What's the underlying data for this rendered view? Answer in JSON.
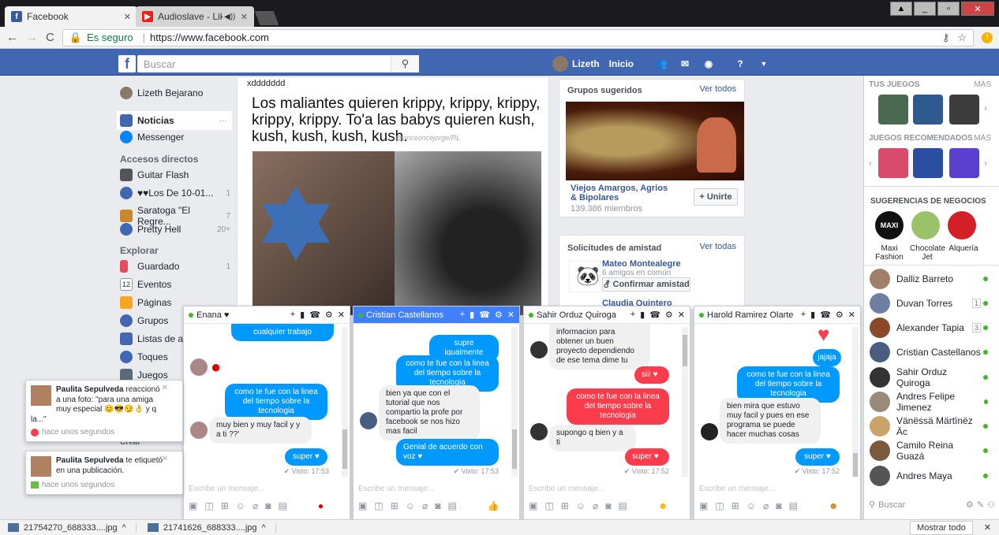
{
  "browser": {
    "tabs": [
      {
        "title": "Facebook",
        "active": true
      },
      {
        "title": "Audioslave - Like a St",
        "active": false
      }
    ],
    "secure_label": "Es seguro",
    "url": "https://www.facebook.com",
    "downloads": [
      "21754270_688333....jpg",
      "21741626_688333....jpg"
    ],
    "show_all": "Mostrar todo"
  },
  "fb_header": {
    "search_placeholder": "Buscar",
    "user_name": "Lizeth",
    "home_label": "Inicio",
    "brand_color": "#4267b2"
  },
  "left_nav": {
    "profile": "Lizeth Bejarano",
    "items": [
      {
        "label": "Noticias",
        "extra": "···"
      },
      {
        "label": "Messenger",
        "extra": ""
      }
    ],
    "shortcuts_title": "Accesos directos",
    "shortcuts": [
      {
        "label": "Guitar Flash",
        "count": ""
      },
      {
        "label": "♥♥Los De 10-01...",
        "count": "1"
      },
      {
        "label": "Saratoga \"El Regre...",
        "count": "7"
      },
      {
        "label": "Pretty Hell",
        "count": "20+"
      }
    ],
    "explore_title": "Explorar",
    "explore": [
      {
        "label": "Guardado",
        "count": "1"
      },
      {
        "label": "Eventos",
        "count": ""
      },
      {
        "label": "Páginas",
        "count": ""
      },
      {
        "label": "Grupos",
        "count": ""
      },
      {
        "label": "Listas de am",
        "count": ""
      },
      {
        "label": "Toques",
        "count": ""
      },
      {
        "label": "Juegos",
        "count": ""
      }
    ],
    "create": "Crear"
  },
  "post": {
    "author_line": "xddddddd",
    "text": "Los maliantes quieren krippy, krippy, krippy, krippy, krippy. To'a las babys quieren kush, kush, kush, kush, kush.",
    "watermark": "@onceoncejorge/RL"
  },
  "suggested_groups": {
    "title": "Grupos sugeridos",
    "see_all": "Ver todos",
    "group_name": "Viejos Amargos, Agrios & Bipolares",
    "members": "139.386 miembros",
    "join": "+ Unirte"
  },
  "friend_requests": {
    "title": "Solicitudes de amistad",
    "see_all": "Ver todas",
    "requests": [
      {
        "name": "Mateo Montealegre",
        "mutual": "6 amigos en común",
        "confirm": "Confirmar amistad"
      },
      {
        "name": "Claudia Quintero",
        "mutual": "",
        "confirm": ""
      }
    ]
  },
  "sidebar": {
    "games_title": "TUS JUEGOS",
    "more": "MÁS",
    "recommended_title": "JUEGOS RECOMENDADOS",
    "business_title": "SUGERENCIAS DE NEGOCIOS",
    "businesses": [
      "Maxi Fashion",
      "Chocolate Jet",
      "Alquería"
    ],
    "contacts": [
      {
        "name": "Dalliz Barreto",
        "badge": ""
      },
      {
        "name": "Duvan Torres",
        "badge": "1"
      },
      {
        "name": "Alexander Tapia",
        "badge": "3"
      },
      {
        "name": "Cristian Castellanos",
        "badge": ""
      },
      {
        "name": "Sahir Orduz Quiroga",
        "badge": ""
      },
      {
        "name": "Andres Felipe Jimenez",
        "badge": ""
      },
      {
        "name": "Vänëssä Märtïnëz Äc",
        "badge": ""
      },
      {
        "name": "Camilo Reina Guazá",
        "badge": ""
      },
      {
        "name": "Andres Maya",
        "badge": ""
      }
    ],
    "search_placeholder": "Buscar"
  },
  "chats": [
    {
      "name": "Enana ♥",
      "messages": [
        {
          "side": "me",
          "text": "cualquier trabajo"
        },
        {
          "side": "me",
          "text": "como te fue con la linea del tiempo sobre la tecnologia"
        },
        {
          "side": "they",
          "text": "muy bien y muy facil y y a ti ??'"
        },
        {
          "side": "me",
          "text": "super ♥"
        }
      ],
      "seen": "✔ Visto: 17:53",
      "placeholder": "Escribe un mensaje..."
    },
    {
      "name": "Cristian Castellanos",
      "messages": [
        {
          "side": "me",
          "text": "supre igualmente"
        },
        {
          "side": "me",
          "text": "como te fue con la linea del tiempo sobre la tecnologia"
        },
        {
          "side": "they",
          "text": "bien ya que con el tutorial que nos compartio la profe por facebook se nos hizo mas facil"
        },
        {
          "side": "me",
          "text": "Genial de acuerdo con voz ♥"
        }
      ],
      "seen": "✔ Visto: 17:53",
      "placeholder": "Escribe un mensaje..."
    },
    {
      "name": "Sahir Orduz Quiroga",
      "messages": [
        {
          "side": "they",
          "text": "informacion para obtener un buen proyecto dependiendo de ese tema dime tu"
        },
        {
          "side": "me",
          "text": "siii ♥"
        },
        {
          "side": "me",
          "text": "como te fue con la linea del tiempo sobre la tecnologia"
        },
        {
          "side": "they",
          "text": "supongo q bien y a ti"
        },
        {
          "side": "me",
          "text": "super ♥"
        }
      ],
      "seen": "✔ Visto: 17:52",
      "placeholder": "Escribe un mensaje..."
    },
    {
      "name": "Harold Ramirez Olarte",
      "messages": [
        {
          "side": "me",
          "text": "jajaja"
        },
        {
          "side": "me",
          "text": "como te fue con la linea del tiempo sobre la tecnologia"
        },
        {
          "side": "they",
          "text": "bien mira que estuvo muy facil y pues en ese programa se puede hacer muchas cosas"
        },
        {
          "side": "me",
          "text": "super ♥"
        }
      ],
      "seen": "✔ Visto: 17:52",
      "placeholder": "Escribe un mensaje..."
    }
  ],
  "notifications": [
    {
      "text_name": "Paulita Sepulveda",
      "text": " reaccionó a una foto: \"para una amiga muy especial 😊😎😏👌 y q la...\"",
      "time": "hace unos segundos"
    },
    {
      "text_name": "Paulita Sepulveda",
      "text": " te etiquetó en una publicación.",
      "time": "hace unos segundos"
    }
  ],
  "misc": {
    "events_icon_num": "12"
  }
}
